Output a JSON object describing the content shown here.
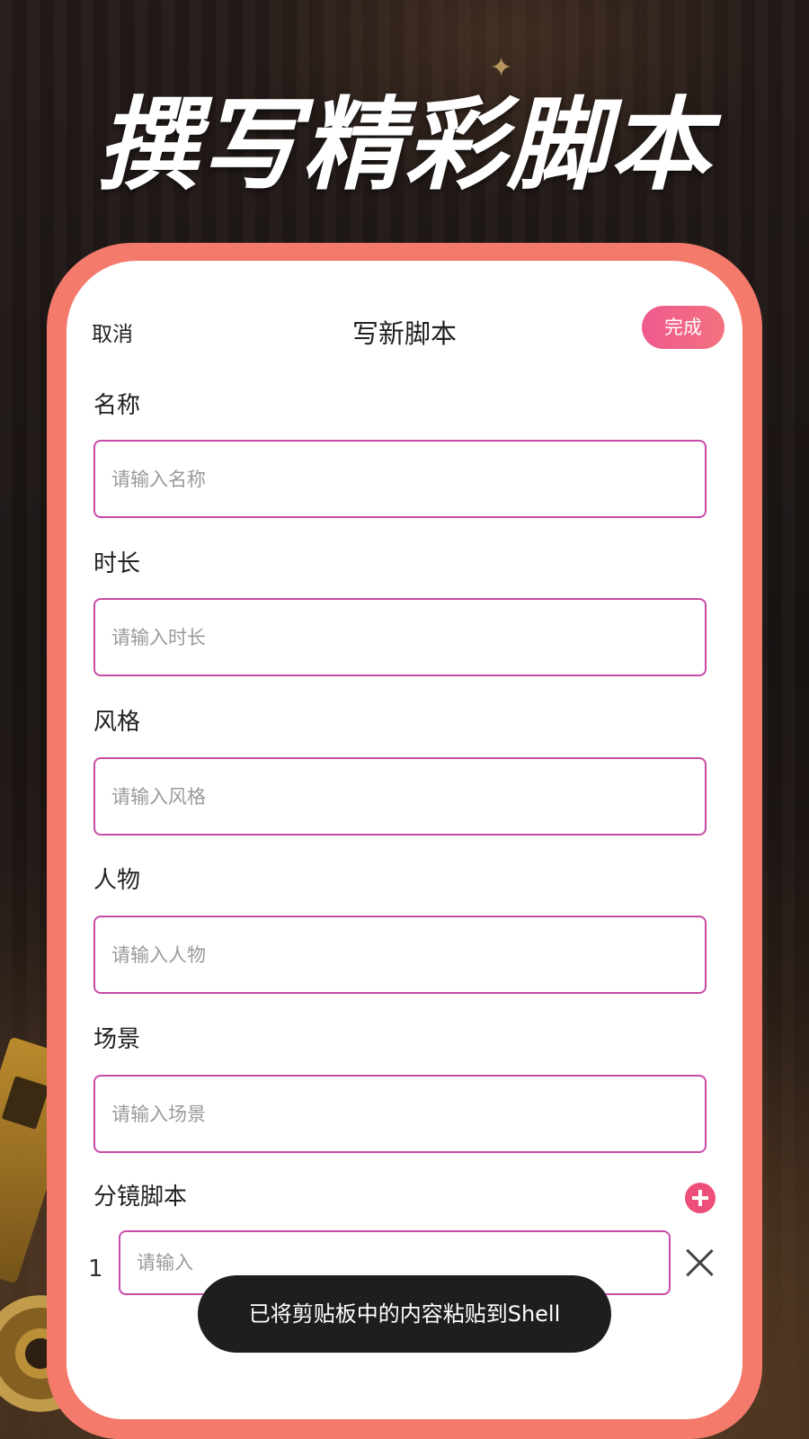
{
  "banner": {
    "title": "撰写精彩脚本"
  },
  "nav": {
    "cancel_label": "取消",
    "title": "写新脚本",
    "done_label": "完成"
  },
  "fields": [
    {
      "label": "名称",
      "placeholder": "请输入名称",
      "value": ""
    },
    {
      "label": "时长",
      "placeholder": "请输入时长",
      "value": ""
    },
    {
      "label": "风格",
      "placeholder": "请输入风格",
      "value": ""
    },
    {
      "label": "人物",
      "placeholder": "请输入人物",
      "value": ""
    },
    {
      "label": "场景",
      "placeholder": "请输入场景",
      "value": ""
    }
  ],
  "storyboard": {
    "label": "分镜脚本",
    "add_icon": "plus-circle-icon",
    "rows": [
      {
        "index": "1",
        "placeholder": "请输入",
        "value": "",
        "remove_icon": "close-icon"
      }
    ]
  },
  "toast": {
    "message": "已将剪贴板中的内容粘贴到Shell"
  },
  "colors": {
    "frame": "#f47a6c",
    "accent": "#ee4f7a",
    "input_border": "#c94aa6",
    "background": "#1c1614"
  }
}
